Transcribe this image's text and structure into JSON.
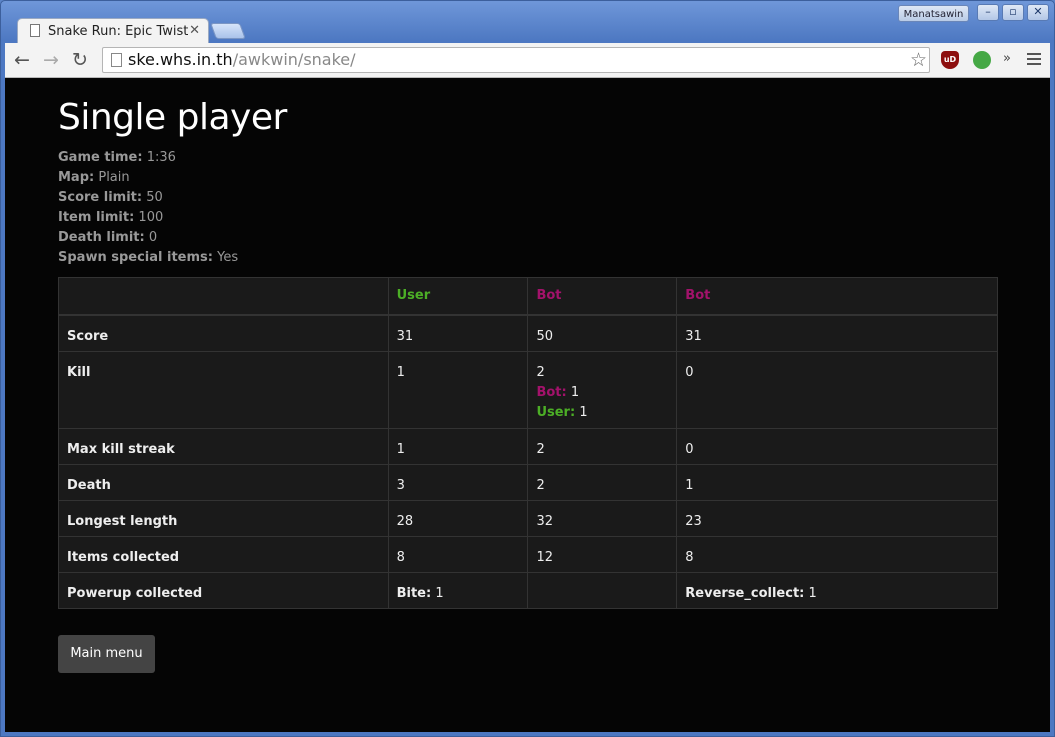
{
  "browser": {
    "tab_title": "Snake Run: Epic Twist",
    "tab_close": "✕",
    "profile_name": "Manatsawin",
    "url_host": "ske.whs.in.th",
    "url_path": "/awkwin/snake/",
    "ublock_badge": "uD",
    "window_controls": [
      "–",
      "▫",
      "✕"
    ],
    "overflow_glyph": "»"
  },
  "page": {
    "title": "Single player",
    "info": [
      {
        "label": "Game time:",
        "value": "1:36"
      },
      {
        "label": "Map:",
        "value": "Plain"
      },
      {
        "label": "Score limit:",
        "value": "50"
      },
      {
        "label": "Item limit:",
        "value": "100"
      },
      {
        "label": "Death limit:",
        "value": "0"
      },
      {
        "label": "Spawn special items:",
        "value": "Yes"
      }
    ],
    "table": {
      "headers": [
        {
          "text": "",
          "color": ""
        },
        {
          "text": "User",
          "color": "#4caf26"
        },
        {
          "text": "Bot",
          "color": "#a3126b"
        },
        {
          "text": "Bot",
          "color": "#a3126b"
        }
      ],
      "rows": [
        {
          "label": "Score",
          "cells": [
            "31",
            "50",
            "31"
          ]
        },
        {
          "label": "Kill",
          "cells": [
            "1",
            "2",
            "0"
          ],
          "kill_breakdown": [
            {
              "name": "Bot:",
              "count": "1"
            },
            {
              "name": "User:",
              "count": "1"
            }
          ]
        },
        {
          "label": "Max kill streak",
          "cells": [
            "1",
            "2",
            "0"
          ]
        },
        {
          "label": "Death",
          "cells": [
            "3",
            "2",
            "1"
          ]
        },
        {
          "label": "Longest length",
          "cells": [
            "28",
            "32",
            "23"
          ]
        },
        {
          "label": "Items collected",
          "cells": [
            "8",
            "12",
            "8"
          ]
        },
        {
          "label": "Powerup collected",
          "powerups": [
            {
              "name": "Bite:",
              "count": "1"
            },
            {
              "name": "",
              "count": ""
            },
            {
              "name": "Reverse_collect:",
              "count": "1"
            }
          ]
        }
      ]
    },
    "main_menu_label": "Main menu"
  }
}
